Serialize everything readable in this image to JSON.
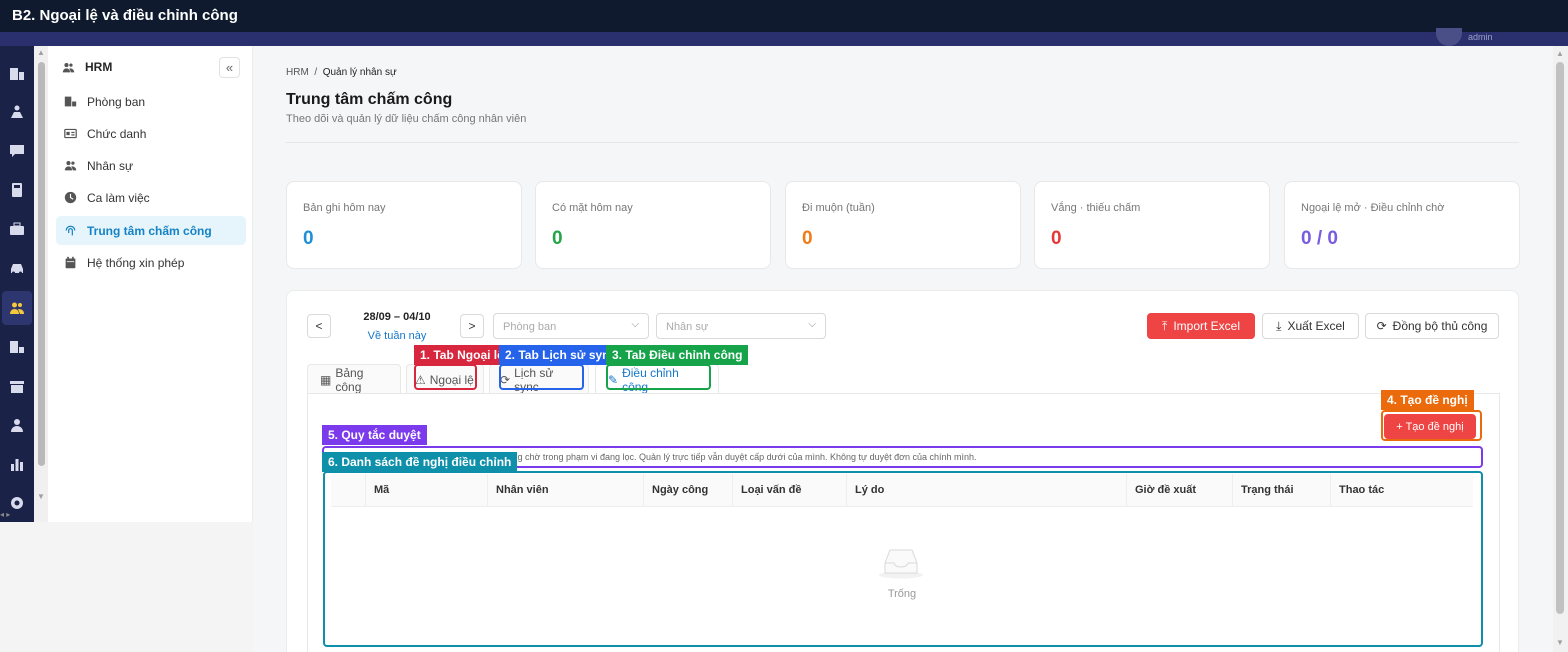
{
  "window_title": "B2. Ngoại lệ và điều chỉnh công",
  "sidebar": {
    "title": "HRM",
    "collapse_glyph": "«",
    "items": [
      {
        "label": "Phòng ban",
        "icon": "department-icon"
      },
      {
        "label": "Chức danh",
        "icon": "id-card-icon"
      },
      {
        "label": "Nhân sự",
        "icon": "users-icon"
      },
      {
        "label": "Ca làm việc",
        "icon": "clock-icon"
      },
      {
        "label": "Trung tâm chấm công",
        "icon": "fingerprint-icon",
        "active": true
      },
      {
        "label": "Hệ thống xin phép",
        "icon": "calendar-icon"
      }
    ]
  },
  "breadcrumb": {
    "root": "HRM",
    "sep": "/",
    "current": "Quản lý nhân sự"
  },
  "page": {
    "title": "Trung tâm chấm công",
    "subtitle": "Theo dõi và quản lý dữ liệu chấm công nhân viên"
  },
  "stats": [
    {
      "label": "Bản ghi hôm nay",
      "value": "0",
      "color": "#1f8fd8"
    },
    {
      "label": "Có mặt hôm nay",
      "value": "0",
      "color": "#22a447"
    },
    {
      "label": "Đi muộn (tuần)",
      "value": "0",
      "color": "#f07a14"
    },
    {
      "label": "Vắng · thiếu chấm",
      "value": "0",
      "color": "#e53935"
    },
    {
      "label": "Ngoại lệ mở · Điều chỉnh chờ",
      "value": "0 / 0",
      "color": "#7a5ce0"
    }
  ],
  "toolbar": {
    "week_range": "28/09 – 04/10",
    "this_week": "Về tuần này",
    "department_placeholder": "Phòng ban",
    "employee_placeholder": "Nhân sự",
    "import_label": "Import Excel",
    "export_label": "Xuất Excel",
    "sync_label": "Đồng bộ thủ công"
  },
  "tabs": [
    {
      "label": "Bảng công"
    },
    {
      "label": "Ngoại lệ"
    },
    {
      "label": "Lịch sử sync"
    },
    {
      "label": "Điều chỉnh công",
      "active": true
    }
  ],
  "create_button": "+ Tạo đề nghị",
  "rule_text": "ị đang chờ trong phạm vi đang lọc. Quản lý trực tiếp vẫn duyệt cấp dưới của mình. Không tự duyệt đơn của chính mình.",
  "table": {
    "columns": [
      "Mã",
      "Nhân viên",
      "Ngày công",
      "Loại vấn đề",
      "Lý do",
      "Giờ đề xuất",
      "Trạng thái",
      "Thao tác"
    ],
    "empty_text": "Trống"
  },
  "annotations": [
    {
      "label": "1. Tab Ngoại lệ",
      "color": "#d7263d"
    },
    {
      "label": "2. Tab Lịch sử sync",
      "color": "#2563eb"
    },
    {
      "label": "3. Tab Điều chỉnh công",
      "color": "#16a34a"
    },
    {
      "label": "4. Tạo đề nghị",
      "color": "#ea6a0c"
    },
    {
      "label": "5. Quy tắc duyệt",
      "color": "#7c3aed"
    },
    {
      "label": "6. Danh sách đề nghị điều chỉnh",
      "color": "#0e90aa"
    }
  ]
}
